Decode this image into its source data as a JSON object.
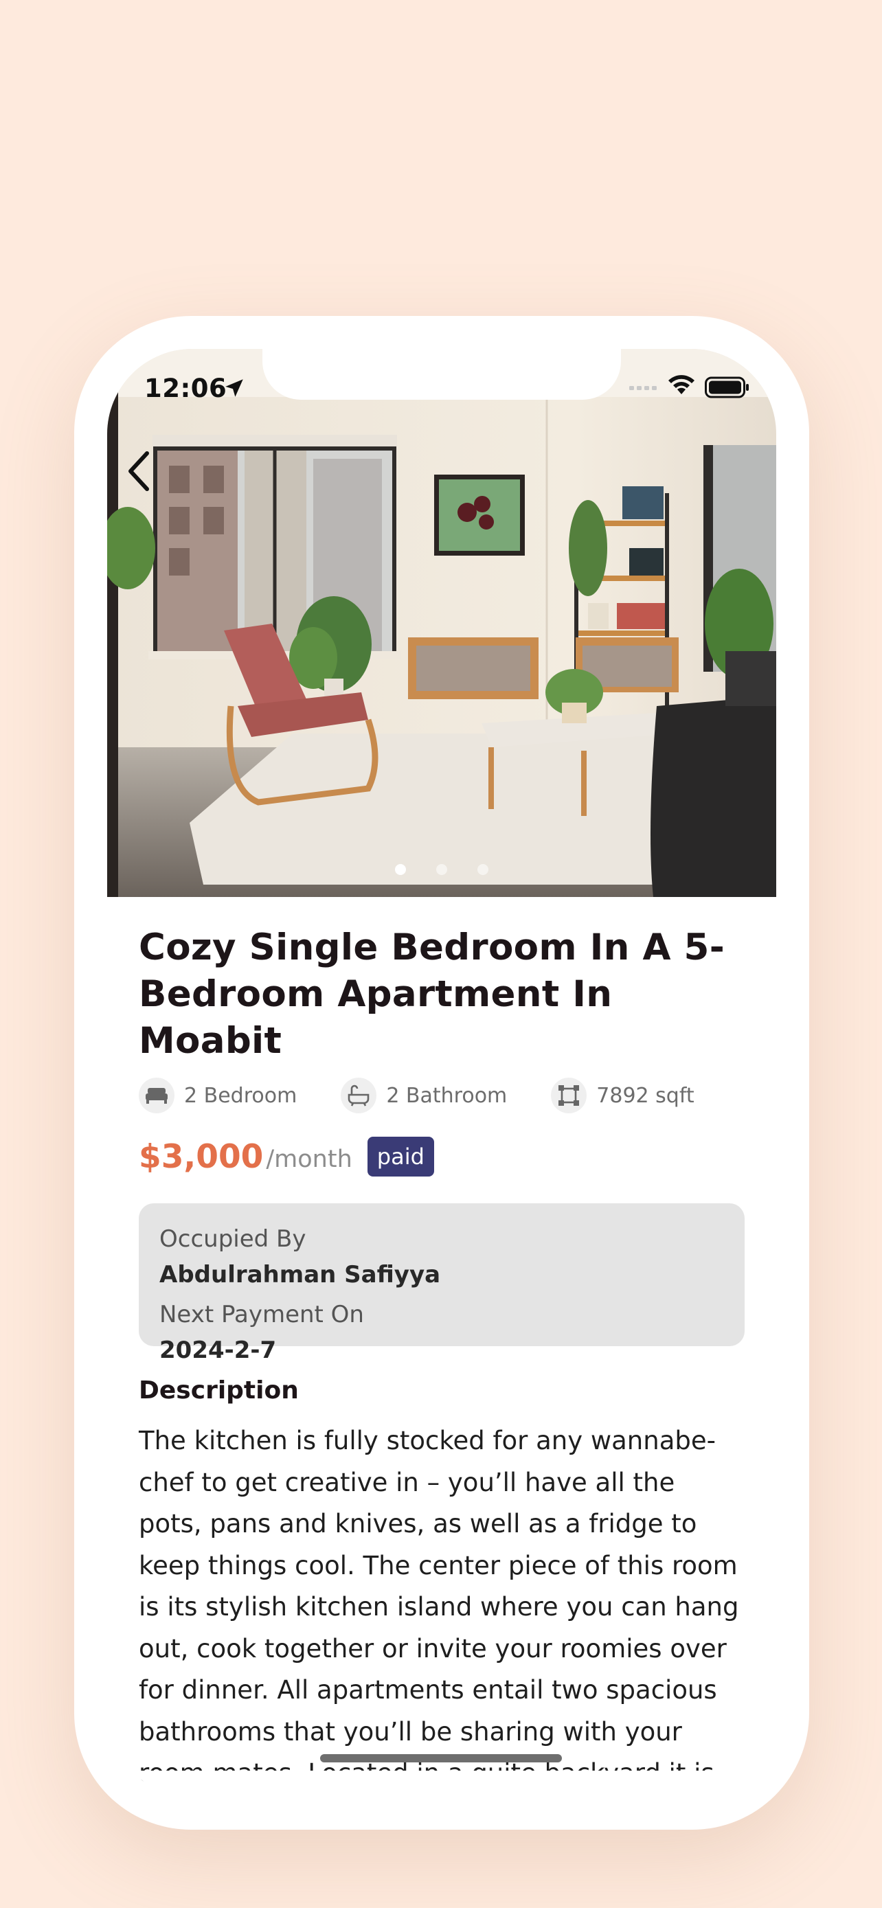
{
  "status_bar": {
    "time": "12:06"
  },
  "listing": {
    "title": "Cozy Single Bedroom In A 5-Bedroom Apartment In Moabit",
    "features": [
      {
        "icon": "bed-icon",
        "label": "2 Bedroom"
      },
      {
        "icon": "bathtub-icon",
        "label": "2 Bathroom"
      },
      {
        "icon": "area-icon",
        "label": "7892 sqft"
      }
    ],
    "price": "$3,000",
    "price_period": "/month",
    "status_badge": "paid",
    "image_pager": {
      "count": 3,
      "active_index": 0
    }
  },
  "occupancy": {
    "occupied_label": "Occupied By",
    "occupant_name": "Abdulrahman Safiyya",
    "next_payment_label": "Next Payment On",
    "next_payment_date": "2024-2-7"
  },
  "description": {
    "heading": "Description",
    "text": "The kitchen is fully stocked for any wannabe-chef to get creative in – you’ll have all the pots, pans and knives, as well as a fridge to keep things cool. The center piece of this room is its stylish kitchen island where you can hang out, cook together or invite your roomies over for dinner. All apartments entail two spacious bathrooms that you’ll be sharing with your room mates. Located in a quite backyard it is provided by a story a long all the highlights"
  },
  "colors": {
    "page_background": "#feeadd",
    "price": "#e3704a",
    "badge": "#3a3b76",
    "card": "#e4e4e4",
    "title": "#1d1518"
  }
}
